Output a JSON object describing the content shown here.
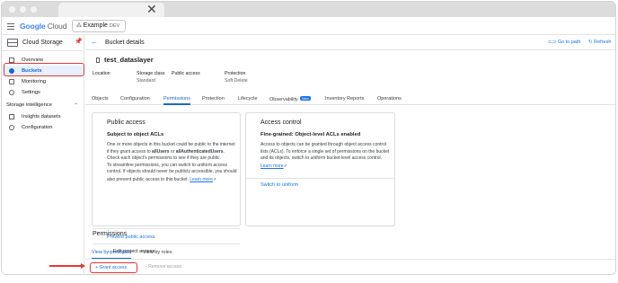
{
  "browser": {
    "close_glyph": "✕"
  },
  "topbar": {
    "logo_google": "Google",
    "logo_cloud": "Cloud",
    "project": "Example",
    "project_env": "DEV"
  },
  "sidebar": {
    "title": "Cloud Storage",
    "items": [
      {
        "label": "Overview"
      },
      {
        "label": "Buckets",
        "active": true
      },
      {
        "label": "Monitoring"
      },
      {
        "label": "Settings"
      }
    ],
    "section": "Storage intelligence",
    "section_items": [
      {
        "label": "Insights datasets"
      },
      {
        "label": "Configuration"
      }
    ]
  },
  "header": {
    "title": "Bucket details",
    "go_to_path": "Go to path",
    "refresh": "Refresh"
  },
  "bucket": {
    "name": "test_dataslayer"
  },
  "meta": [
    {
      "key": "Location",
      "value": ""
    },
    {
      "key": "Storage class",
      "value": "Standard"
    },
    {
      "key": "Public access",
      "value": ""
    },
    {
      "key": "Protection",
      "value": "Soft Delete"
    }
  ],
  "tabs": [
    "Objects",
    "Configuration",
    "Permissions",
    "Protection",
    "Lifecycle",
    "Observability",
    "Inventory Reports",
    "Operations"
  ],
  "tab_badge": "New",
  "public_access": {
    "title": "Public access",
    "subtitle": "Subject to object ACLs",
    "body1": "One or more objects in this bucket could be public to the internet if they grant access to",
    "all_users": "allUsers",
    "or": "or",
    "all_auth": "allAuthenticatedUsers",
    "body2": ". Check each object's permissions to see if they are public.",
    "body3": "To streamline permissions, you can switch to uniform access control. If objects should never be publicly accessible, you should also prevent public access to this bucket.",
    "learn_more": "Learn more",
    "prevent": "Prevent public access",
    "edit_project": "Edit project access"
  },
  "access_control": {
    "title": "Access control",
    "subtitle": "Fine-grained: Object-level ACLs enabled",
    "body": "Access to objects can be granted through object access control lists (ACLs). To enforce a single set of permissions on the bucket and its objects, switch to uniform bucket-level access control.",
    "learn_more": "Learn more",
    "switch": "Switch to uniform"
  },
  "permissions": {
    "title": "Permissions",
    "tabs": [
      "View by principals",
      "View by roles"
    ],
    "grant": "Grant access",
    "remove": "Remove access"
  }
}
